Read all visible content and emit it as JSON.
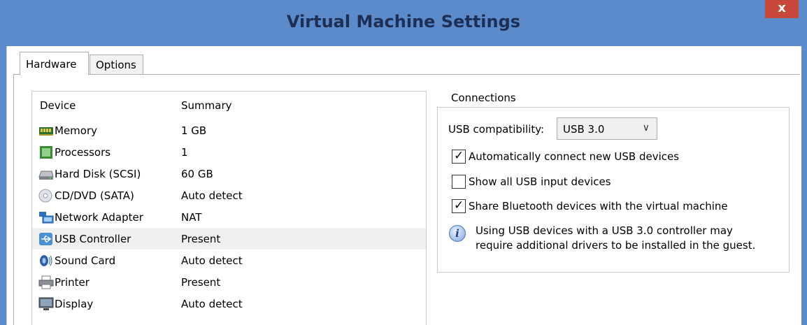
{
  "window": {
    "title": "Virtual Machine Settings",
    "close_label": "x"
  },
  "tabs": [
    {
      "label": "Hardware"
    },
    {
      "label": "Options"
    }
  ],
  "device_list": {
    "columns": {
      "device": "Device",
      "summary": "Summary"
    },
    "rows": [
      {
        "device": "Memory",
        "summary": "1 GB",
        "icon": "memory-icon"
      },
      {
        "device": "Processors",
        "summary": "1",
        "icon": "processor-icon"
      },
      {
        "device": "Hard Disk (SCSI)",
        "summary": "60 GB",
        "icon": "hard-disk-icon"
      },
      {
        "device": "CD/DVD (SATA)",
        "summary": "Auto detect",
        "icon": "cd-dvd-icon"
      },
      {
        "device": "Network Adapter",
        "summary": "NAT",
        "icon": "network-adapter-icon"
      },
      {
        "device": "USB Controller",
        "summary": "Present",
        "icon": "usb-icon",
        "selected": true
      },
      {
        "device": "Sound Card",
        "summary": "Auto detect",
        "icon": "sound-card-icon"
      },
      {
        "device": "Printer",
        "summary": "Present",
        "icon": "printer-icon"
      },
      {
        "device": "Display",
        "summary": "Auto detect",
        "icon": "display-icon"
      }
    ]
  },
  "connections": {
    "legend": "Connections",
    "usb_compat_label": "USB compatibility:",
    "usb_compat_value": "USB 3.0",
    "auto_connect": {
      "label": "Automatically connect new USB devices",
      "checked": true
    },
    "show_all_input": {
      "label": "Show all USB input devices",
      "checked": false
    },
    "share_bluetooth": {
      "label": "Share Bluetooth devices with the virtual machine",
      "checked": true
    },
    "info_line1": "Using USB devices with a USB 3.0 controller may",
    "info_line2": "require additional drivers to be installed in the guest."
  },
  "colors": {
    "titlebar": "#5b8bca",
    "close_button": "#c7473b",
    "selected_row": "#f0f0f0"
  }
}
